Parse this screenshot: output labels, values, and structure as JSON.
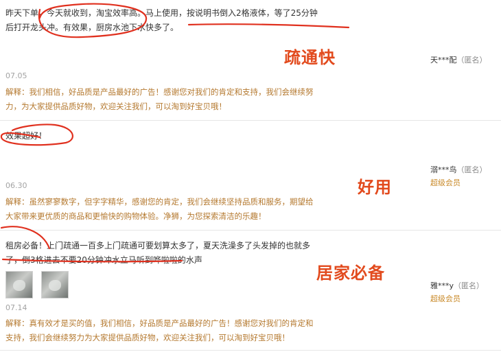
{
  "reviews": [
    {
      "content": "昨天下单，今天就收到，淘宝效率高。马上使用，按说明书倒入2格液体，等了25分钟后打开龙头冲。有效果，厨房水池下水快多了。",
      "date": "07.05",
      "reply": "解释：我们相信，好品质是产品最好的广告！感谢您对我们的肯定和支持，我们会继续努力，为大家提供品质好物，欢迎关注我们，可以淘到好宝贝哦！",
      "user": "天***配",
      "anonymous": "（匿名）",
      "badge": "",
      "annotation": "疏通快"
    },
    {
      "content": "效果超好！",
      "date": "06.30",
      "reply": "解释：虽然寥寥数字，但字字精华，感谢您的肯定，我们会继续坚持品质和服务，期望给大家带来更优质的商品和更愉快的购物体验。净狮，为您探索清洁的乐趣！",
      "user": "溺***鸟",
      "anonymous": "（匿名）",
      "badge": "超级会员",
      "annotation": "好用"
    },
    {
      "content": "租房必备！上门疏通一百多上门疏通可要划算太多了，夏天洗澡多了头发掉的也就多了，倒3格进去不要20分钟冲水立马听到哗啦啦的水声",
      "date": "07.14",
      "reply": "解释：真有效才是买的值，我们相信，好品质是产品最好的广告！感谢您对我们的肯定和支持，我们会继续努力为大家提供品质好物，欢迎关注我们，可以淘到好宝贝哦！",
      "user": "雅***y",
      "anonymous": "（匿名）",
      "badge": "超级会员",
      "annotation": "居家必备",
      "photos": [
        "review-photo",
        "review-photo"
      ]
    }
  ],
  "colors": {
    "reply_text": "#b4782e",
    "annotation": "#e24a1d",
    "badge": "#c98a29",
    "date": "#a3a3a3"
  }
}
